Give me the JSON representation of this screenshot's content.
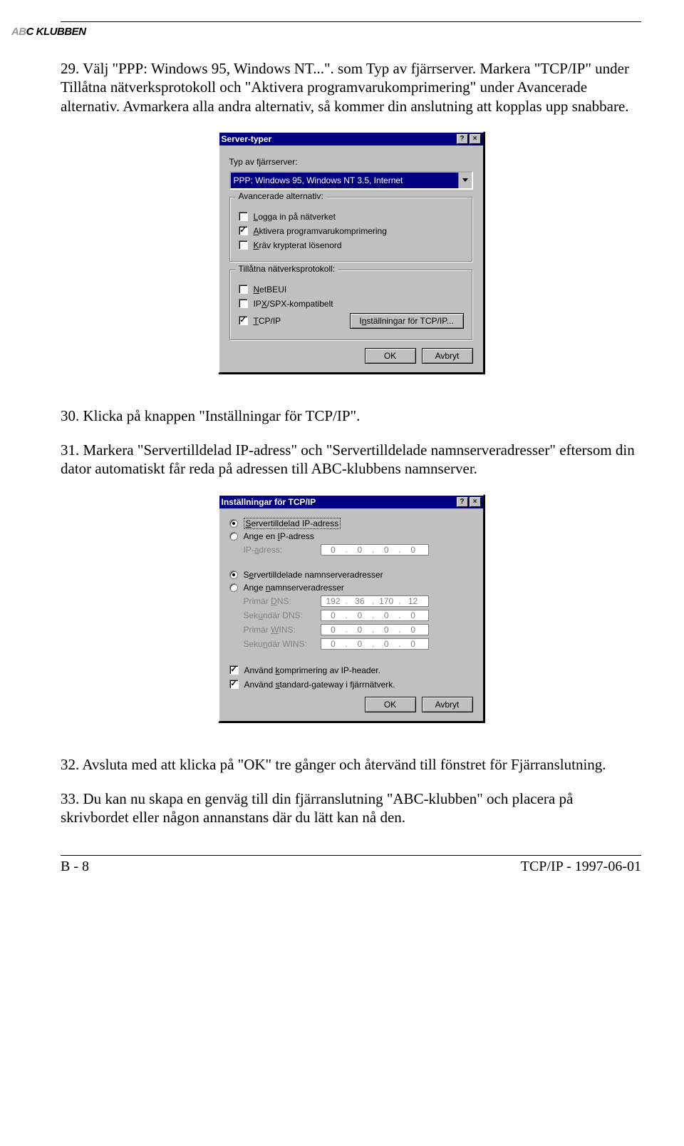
{
  "logo": {
    "a": "AB",
    "rest": "C KLUBBEN"
  },
  "para29": "29. Välj \"PPP: Windows 95, Windows NT...\". som Typ av fjärrserver. Markera \"TCP/IP\" under Tillåtna nätverksprotokoll och \"Aktivera programvarukomprimering\" under Avancerade alternativ. Avmarkera alla andra alternativ, så kommer din anslutning att kopplas upp snabbare.",
  "para30": "30. Klicka på knappen \"Inställningar för TCP/IP\".",
  "para31": "31. Markera \"Servertilldelad IP-adress\" och \"Servertilldelade namnserveradresser\" eftersom din dator automatiskt får reda på adressen till ABC-klubbens namnserver.",
  "para32": "32. Avsluta med att klicka på \"OK\" tre gånger och återvänd till fönstret för Fjärranslutning.",
  "para33": "33. Du kan nu skapa en genväg till din fjärranslutning \"ABC-klubben\" och placera på skrivbordet eller någon annanstans där du lätt kan nå den.",
  "footer": {
    "left": "B - 8",
    "right": "TCP/IP - 1997-06-01"
  },
  "dialog1": {
    "title": "Server-typer",
    "help": "?",
    "close": "×",
    "typ_label": "Typ av fjärrserver:",
    "select_value": "PPP: Windows 95, Windows NT 3.5, Internet",
    "group_adv": "Avancerade alternativ:",
    "adv": [
      {
        "checked": false,
        "label_u": "L",
        "label_rest": "ogga in på nätverket"
      },
      {
        "checked": true,
        "label_u": "A",
        "label_rest": "ktivera programvarukomprimering"
      },
      {
        "checked": false,
        "label_u": "K",
        "label_rest": "räv krypterat lösenord"
      }
    ],
    "group_proto": "Tillåtna nätverksprotokoll:",
    "proto": [
      {
        "checked": false,
        "label_u": "N",
        "label_rest": "etBEUI"
      },
      {
        "checked": false,
        "label_pre": "IP",
        "label_u": "X",
        "label_rest": "/SPX-kompatibelt"
      },
      {
        "checked": true,
        "label_u": "T",
        "label_rest": "CP/IP"
      }
    ],
    "settings_btn_pre": "I",
    "settings_btn_u": "n",
    "settings_btn_rest": "ställningar för TCP/IP...",
    "ok": "OK",
    "cancel": "Avbryt"
  },
  "dialog2": {
    "title": "Inställningar för TCP/IP",
    "help": "?",
    "close": "×",
    "r1": {
      "selected": true,
      "pre": "",
      "u": "S",
      "mid": "",
      "rest": "ervertilldelad IP-adress"
    },
    "r2": {
      "selected": false,
      "pre": "Ange en ",
      "u": "I",
      "mid": "",
      "rest": "P-adress"
    },
    "ip_addr_label_pre": "IP-",
    "ip_addr_label_u": "a",
    "ip_addr_label_rest": "dress:",
    "ip_addr": [
      "0",
      "0",
      "0",
      "0"
    ],
    "r3": {
      "selected": true,
      "pre": "S",
      "u": "e",
      "mid": "",
      "rest": "rvertilldelade namnserveradresser"
    },
    "r4": {
      "selected": false,
      "pre": "Ange ",
      "u": "n",
      "mid": "",
      "rest": "amnserveradresser"
    },
    "rows": [
      {
        "label_pre": "Primär ",
        "label_u": "D",
        "label_rest": "NS:",
        "oct": [
          "192",
          "36",
          "170",
          "12"
        ]
      },
      {
        "label_pre": "Sek",
        "label_u": "u",
        "label_rest": "ndär DNS:",
        "oct": [
          "0",
          "0",
          "0",
          "0"
        ]
      },
      {
        "label_pre": "Primär ",
        "label_u": "W",
        "label_rest": "INS:",
        "oct": [
          "0",
          "0",
          "0",
          "0"
        ]
      },
      {
        "label_pre": "Seku",
        "label_u": "n",
        "label_rest": "där WINS:",
        "oct": [
          "0",
          "0",
          "0",
          "0"
        ]
      }
    ],
    "chk1": {
      "checked": true,
      "pre": "Använd ",
      "u": "k",
      "rest": "omprimering av IP-header."
    },
    "chk2": {
      "checked": true,
      "pre": "Använd ",
      "u": "s",
      "rest": "tandard-gateway i fjärrnätverk."
    },
    "ok": "OK",
    "cancel": "Avbryt"
  }
}
